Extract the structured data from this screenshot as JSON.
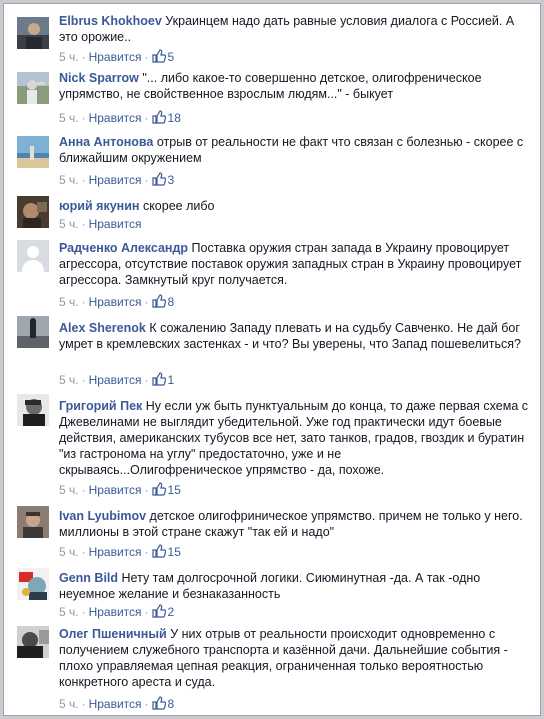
{
  "labels": {
    "like": "Нравится"
  },
  "colors": {
    "link": "#3b5998",
    "meta": "#9197a3",
    "text": "#141823"
  },
  "comments": [
    {
      "author": "Elbrus Khokhoev",
      "text": "Украинцем надо дать равные условия диалога с Россией. А это орожие..",
      "time": "5 ч.",
      "likes": "5",
      "avatar_icon": "profile-photo"
    },
    {
      "author": "Nick Sparrow",
      "text": "\"... либо какое-то совершенно детское, олигофреническое упрямство, не свойственное взрослым людям...\" - быкует",
      "time": "5 ч.",
      "likes": "18",
      "avatar_icon": "profile-photo"
    },
    {
      "author": "Анна Антонова",
      "text": "отрыв от реальности не факт что связан с болезнью - скорее с ближайшим окружением",
      "time": "5 ч.",
      "likes": "3",
      "avatar_icon": "profile-photo"
    },
    {
      "author": "юрий якунин",
      "text": "скорее либо",
      "time": "5 ч.",
      "likes": "",
      "avatar_icon": "profile-photo"
    },
    {
      "author": "Радченко Александр",
      "text": "Поставка оружия стран запада в Украину провоцирует агрессора, отсутствие поставок оружия западных стран в Украину провоцирует агрессора. Замкнутый круг получается.",
      "time": "5 ч.",
      "likes": "8",
      "avatar_icon": "default-avatar"
    },
    {
      "author": "Alex Sherenok",
      "text": "К сожалению Западу плевать и на судьбу Савченко. Не дай бог умрет в кремлевских застенках - и что? Вы уверены, что Запад пошевелиться?",
      "time": "5 ч.",
      "likes": "1",
      "avatar_icon": "profile-photo"
    },
    {
      "author": "Григорий Пек",
      "text": "Ну если уж быть пунктуальным до конца, то даже первая схема с Джевелинами не выглядит убедительной. Уже год практически идут боевые действия, американских тубусов все нет, зато танков, градов, гвоздик и буратин \"из гастронома на углу\" предостаточно, уже и не скрываясь...Олигофреническое упрямство - да, похоже.",
      "time": "5 ч.",
      "likes": "15",
      "avatar_icon": "profile-photo"
    },
    {
      "author": "Ivan Lyubimov",
      "text": "детское олигофриническое упрямство. причем не только у него. миллионы в этой стране скажут \"так ей и надо\"",
      "time": "5 ч.",
      "likes": "15",
      "avatar_icon": "profile-photo"
    },
    {
      "author": "Genn Bild",
      "text": "Нету там долгосрочной логики. Сиюминутная -да. А так -одно неуемное желание и безнаказанность",
      "time": "5 ч.",
      "likes": "2",
      "avatar_icon": "profile-photo"
    },
    {
      "author": "Олег Пшеничный",
      "text": "У них отрыв от реальности происходит одновременно с получением служебного транспорта и казённой дачи. Дальнейшие события - плохо управляемая цепная реакция, ограниченная только вероятностью конкретного ареста и суда.",
      "time": "5 ч.",
      "likes": "8",
      "avatar_icon": "profile-photo"
    }
  ]
}
